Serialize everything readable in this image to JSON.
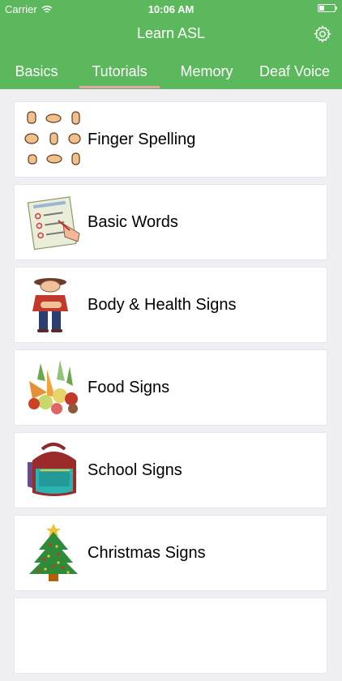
{
  "status_bar": {
    "carrier": "Carrier",
    "time": "10:06 AM"
  },
  "header": {
    "title": "Learn ASL",
    "settings_icon": "gear-icon"
  },
  "tabs": [
    {
      "label": "Basics",
      "active": false
    },
    {
      "label": "Tutorials",
      "active": true
    },
    {
      "label": "Memory",
      "active": false
    },
    {
      "label": "Deaf Voice",
      "active": false
    }
  ],
  "tutorials": [
    {
      "label": "Finger Spelling",
      "icon": "hand-signs-icon"
    },
    {
      "label": "Basic Words",
      "icon": "checklist-icon"
    },
    {
      "label": "Body & Health Signs",
      "icon": "sick-person-icon"
    },
    {
      "label": "Food Signs",
      "icon": "vegetables-icon"
    },
    {
      "label": "School Signs",
      "icon": "backpack-icon"
    },
    {
      "label": "Christmas Signs",
      "icon": "christmas-tree-icon"
    }
  ],
  "colors": {
    "header_green": "#5cb85c",
    "active_tab_underline": "#e8a3a3",
    "background": "#efeff4"
  }
}
